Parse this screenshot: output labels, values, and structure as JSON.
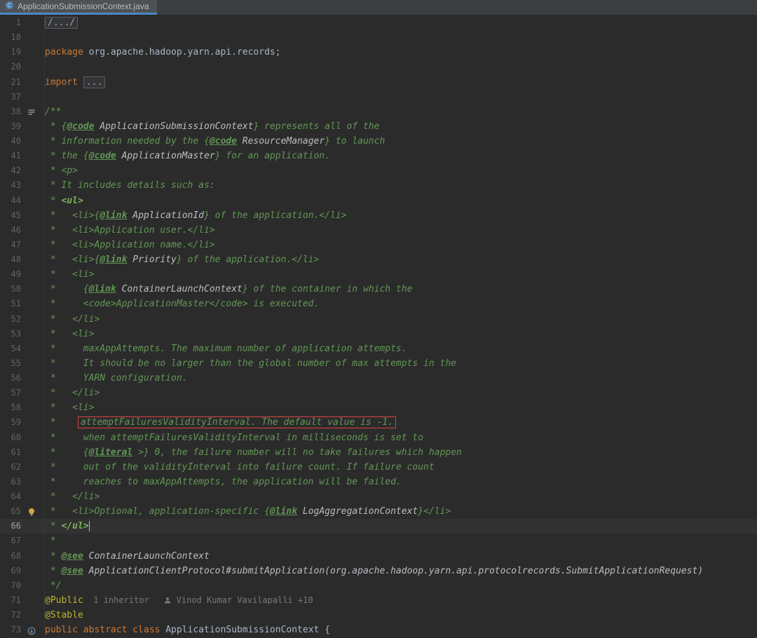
{
  "tab": {
    "title": "ApplicationSubmissionContext.java",
    "icon": "java-class-icon"
  },
  "palette": {
    "bg": "#2B2B2B",
    "tabbar": "#3C3F41",
    "tabbg": "#4E5254",
    "tabline": "#4A88C7",
    "tabfg": "#BBBBBB",
    "fg": "#A9B7C6",
    "kw": "#CC7832",
    "doc": "#629755",
    "mk": "#7CB45B",
    "val": "#BCBEC4",
    "ann": "#BBB529",
    "ln": "#606366",
    "lncur": "#A4A4A4",
    "hint": "#7A7A7A",
    "foldfg": "#9DA0A8",
    "foldborder": "#5A5D63",
    "caretrow": "#323232",
    "red": "#DD4444",
    "gutterborder": "#353739"
  },
  "editor": {
    "lines": [
      {
        "n": "1",
        "segs": [
          {
            "t": "fold",
            "s": "/.../"
          }
        ]
      },
      {
        "n": "18",
        "segs": []
      },
      {
        "n": "19",
        "segs": [
          {
            "t": "kw",
            "s": "package"
          },
          {
            "t": "pl",
            "s": " org.apache.hadoop.yarn.api.records;"
          }
        ]
      },
      {
        "n": "20",
        "segs": []
      },
      {
        "n": "21",
        "segs": [
          {
            "t": "kw",
            "s": "import "
          },
          {
            "t": "fold",
            "s": "..."
          }
        ]
      },
      {
        "n": "37",
        "segs": []
      },
      {
        "n": "38",
        "g": "rendered-doc-toggle-icon",
        "segs": [
          {
            "t": "doc",
            "s": "/**"
          }
        ]
      },
      {
        "n": "39",
        "segs": [
          {
            "t": "doc",
            "s": " * {"
          },
          {
            "t": "tag",
            "s": "@code"
          },
          {
            "t": "doc",
            "s": " "
          },
          {
            "t": "val",
            "s": "ApplicationSubmissionContext"
          },
          {
            "t": "doc",
            "s": "} represents all of the"
          }
        ]
      },
      {
        "n": "40",
        "segs": [
          {
            "t": "doc",
            "s": " * information needed by the {"
          },
          {
            "t": "tag",
            "s": "@code"
          },
          {
            "t": "doc",
            "s": " "
          },
          {
            "t": "val",
            "s": "ResourceManager"
          },
          {
            "t": "doc",
            "s": "} to launch"
          }
        ]
      },
      {
        "n": "41",
        "segs": [
          {
            "t": "doc",
            "s": " * the {"
          },
          {
            "t": "tag",
            "s": "@code"
          },
          {
            "t": "doc",
            "s": " "
          },
          {
            "t": "val",
            "s": "ApplicationMaster"
          },
          {
            "t": "doc",
            "s": "} for an application."
          }
        ]
      },
      {
        "n": "42",
        "segs": [
          {
            "t": "doc",
            "s": " * <p>"
          }
        ]
      },
      {
        "n": "43",
        "segs": [
          {
            "t": "doc",
            "s": " * It includes details such as:"
          }
        ]
      },
      {
        "n": "44",
        "segs": [
          {
            "t": "doc",
            "s": " * "
          },
          {
            "t": "mk",
            "s": "<ul>"
          }
        ]
      },
      {
        "n": "45",
        "segs": [
          {
            "t": "doc",
            "s": " *   <li>{"
          },
          {
            "t": "tag",
            "s": "@link"
          },
          {
            "t": "doc",
            "s": " "
          },
          {
            "t": "val",
            "s": "ApplicationId"
          },
          {
            "t": "doc",
            "s": "} of the application.</li>"
          }
        ]
      },
      {
        "n": "46",
        "segs": [
          {
            "t": "doc",
            "s": " *   <li>Application user.</li>"
          }
        ]
      },
      {
        "n": "47",
        "segs": [
          {
            "t": "doc",
            "s": " *   <li>Application name.</li>"
          }
        ]
      },
      {
        "n": "48",
        "segs": [
          {
            "t": "doc",
            "s": " *   <li>{"
          },
          {
            "t": "tag",
            "s": "@link"
          },
          {
            "t": "doc",
            "s": " "
          },
          {
            "t": "val",
            "s": "Priority"
          },
          {
            "t": "doc",
            "s": "} of the application.</li>"
          }
        ]
      },
      {
        "n": "49",
        "segs": [
          {
            "t": "doc",
            "s": " *   <li>"
          }
        ]
      },
      {
        "n": "50",
        "segs": [
          {
            "t": "doc",
            "s": " *     {"
          },
          {
            "t": "tag",
            "s": "@link"
          },
          {
            "t": "doc",
            "s": " "
          },
          {
            "t": "val",
            "s": "ContainerLaunchContext"
          },
          {
            "t": "doc",
            "s": "} of the container in which the"
          }
        ]
      },
      {
        "n": "51",
        "segs": [
          {
            "t": "doc",
            "s": " *     <code>ApplicationMaster</code> is executed."
          }
        ]
      },
      {
        "n": "52",
        "segs": [
          {
            "t": "doc",
            "s": " *   </li>"
          }
        ]
      },
      {
        "n": "53",
        "segs": [
          {
            "t": "doc",
            "s": " *   <li>"
          }
        ]
      },
      {
        "n": "54",
        "segs": [
          {
            "t": "doc",
            "s": " *     maxAppAttempts. The maximum number of application attempts."
          }
        ]
      },
      {
        "n": "55",
        "segs": [
          {
            "t": "doc",
            "s": " *     It should be no larger than the global number of max attempts in the"
          }
        ]
      },
      {
        "n": "56",
        "segs": [
          {
            "t": "doc",
            "s": " *     YARN configuration."
          }
        ]
      },
      {
        "n": "57",
        "segs": [
          {
            "t": "doc",
            "s": " *   </li>"
          }
        ]
      },
      {
        "n": "58",
        "segs": [
          {
            "t": "doc",
            "s": " *   <li>"
          }
        ]
      },
      {
        "n": "59",
        "segs": [
          {
            "t": "doc",
            "s": " *    "
          },
          {
            "t": "box",
            "s": "attemptFailuresValidityInterval. The default value is -1."
          }
        ]
      },
      {
        "n": "60",
        "segs": [
          {
            "t": "doc",
            "s": " *     when attemptFailuresValidityInterval in milliseconds is set to"
          }
        ]
      },
      {
        "n": "61",
        "segs": [
          {
            "t": "doc",
            "s": " *     {"
          },
          {
            "t": "tag",
            "s": "@literal"
          },
          {
            "t": "doc",
            "s": " >} 0, the failure number will no take failures which happen"
          }
        ]
      },
      {
        "n": "62",
        "segs": [
          {
            "t": "doc",
            "s": " *     out of the validityInterval into failure count. If failure count"
          }
        ]
      },
      {
        "n": "63",
        "segs": [
          {
            "t": "doc",
            "s": " *     reaches to maxAppAttempts, the application will be failed."
          }
        ]
      },
      {
        "n": "64",
        "segs": [
          {
            "t": "doc",
            "s": " *   </li>"
          }
        ]
      },
      {
        "n": "65",
        "g": "lightbulb-icon",
        "segs": [
          {
            "t": "doc",
            "s": " *   <li>Optional, application-specific {"
          },
          {
            "t": "tag",
            "s": "@link"
          },
          {
            "t": "doc",
            "s": " "
          },
          {
            "t": "val",
            "s": "LogAggregationContext"
          },
          {
            "t": "doc",
            "s": "}</li>"
          }
        ]
      },
      {
        "n": "66",
        "c": true,
        "caret": true,
        "segs": [
          {
            "t": "doc",
            "s": " * "
          },
          {
            "t": "mk",
            "s": "</ul>"
          }
        ]
      },
      {
        "n": "67",
        "segs": [
          {
            "t": "doc",
            "s": " *"
          }
        ]
      },
      {
        "n": "68",
        "segs": [
          {
            "t": "doc",
            "s": " * "
          },
          {
            "t": "tag",
            "s": "@see"
          },
          {
            "t": "doc",
            "s": " "
          },
          {
            "t": "val",
            "s": "ContainerLaunchContext"
          }
        ]
      },
      {
        "n": "69",
        "segs": [
          {
            "t": "doc",
            "s": " * "
          },
          {
            "t": "tag",
            "s": "@see"
          },
          {
            "t": "doc",
            "s": " "
          },
          {
            "t": "val",
            "s": "ApplicationClientProtocol#submitApplication(org.apache.hadoop.yarn.api.protocolrecords.SubmitApplicationRequest)"
          }
        ]
      },
      {
        "n": "70",
        "segs": [
          {
            "t": "doc",
            "s": " */"
          }
        ]
      },
      {
        "n": "71",
        "segs": [
          {
            "t": "ann",
            "s": "@Public"
          },
          {
            "t": "hint",
            "s": "  1 inheritor   "
          },
          {
            "t": "ai",
            "s": ""
          },
          {
            "t": "hint",
            "s": " Vinod Kumar Vavilapalli +10"
          }
        ]
      },
      {
        "n": "72",
        "segs": [
          {
            "t": "ann",
            "s": "@Stable"
          }
        ]
      },
      {
        "n": "73",
        "g": "overridden-marker-icon",
        "segs": [
          {
            "t": "kw",
            "s": "public abstract class"
          },
          {
            "t": "pl",
            "s": " "
          },
          {
            "t": "cls",
            "s": "ApplicationSubmissionContext"
          },
          {
            "t": "pl",
            "s": " {"
          }
        ]
      }
    ]
  }
}
